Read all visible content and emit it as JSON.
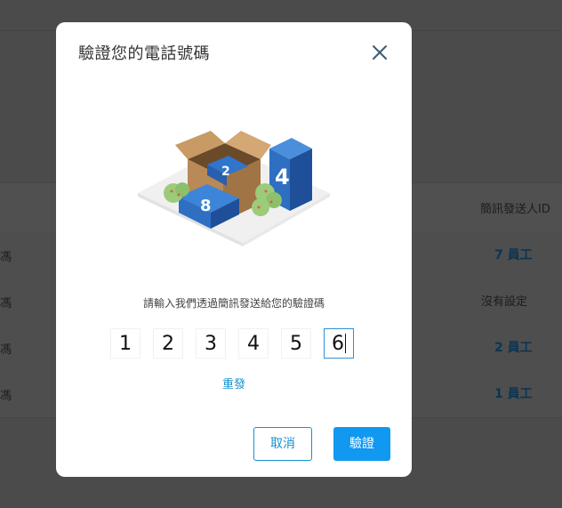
{
  "background": {
    "column_header": "簡訊發送人ID",
    "rows": [
      {
        "left": "馮",
        "right": "7 員工",
        "right_style": "link"
      },
      {
        "left": "馮",
        "right": "沒有設定",
        "right_style": "plain"
      },
      {
        "left": "馮",
        "right": "2 員工",
        "right_style": "link"
      },
      {
        "left": "馮",
        "right": "1 員工",
        "right_style": "link"
      }
    ]
  },
  "modal": {
    "title": "驗證您的電話號碼",
    "close_icon": "close-icon",
    "illustration_icon": "boxes-numbers-illustration",
    "instruction": "請輸入我們透過簡訊發送給您的驗證碼",
    "code_digits": [
      "1",
      "2",
      "3",
      "4",
      "5",
      "6"
    ],
    "resend_label": "重發",
    "cancel_label": "取消",
    "verify_label": "驗證"
  },
  "colors": {
    "accent": "#1198f0",
    "link": "#1890d0",
    "overlay": "#4b4b4b"
  }
}
